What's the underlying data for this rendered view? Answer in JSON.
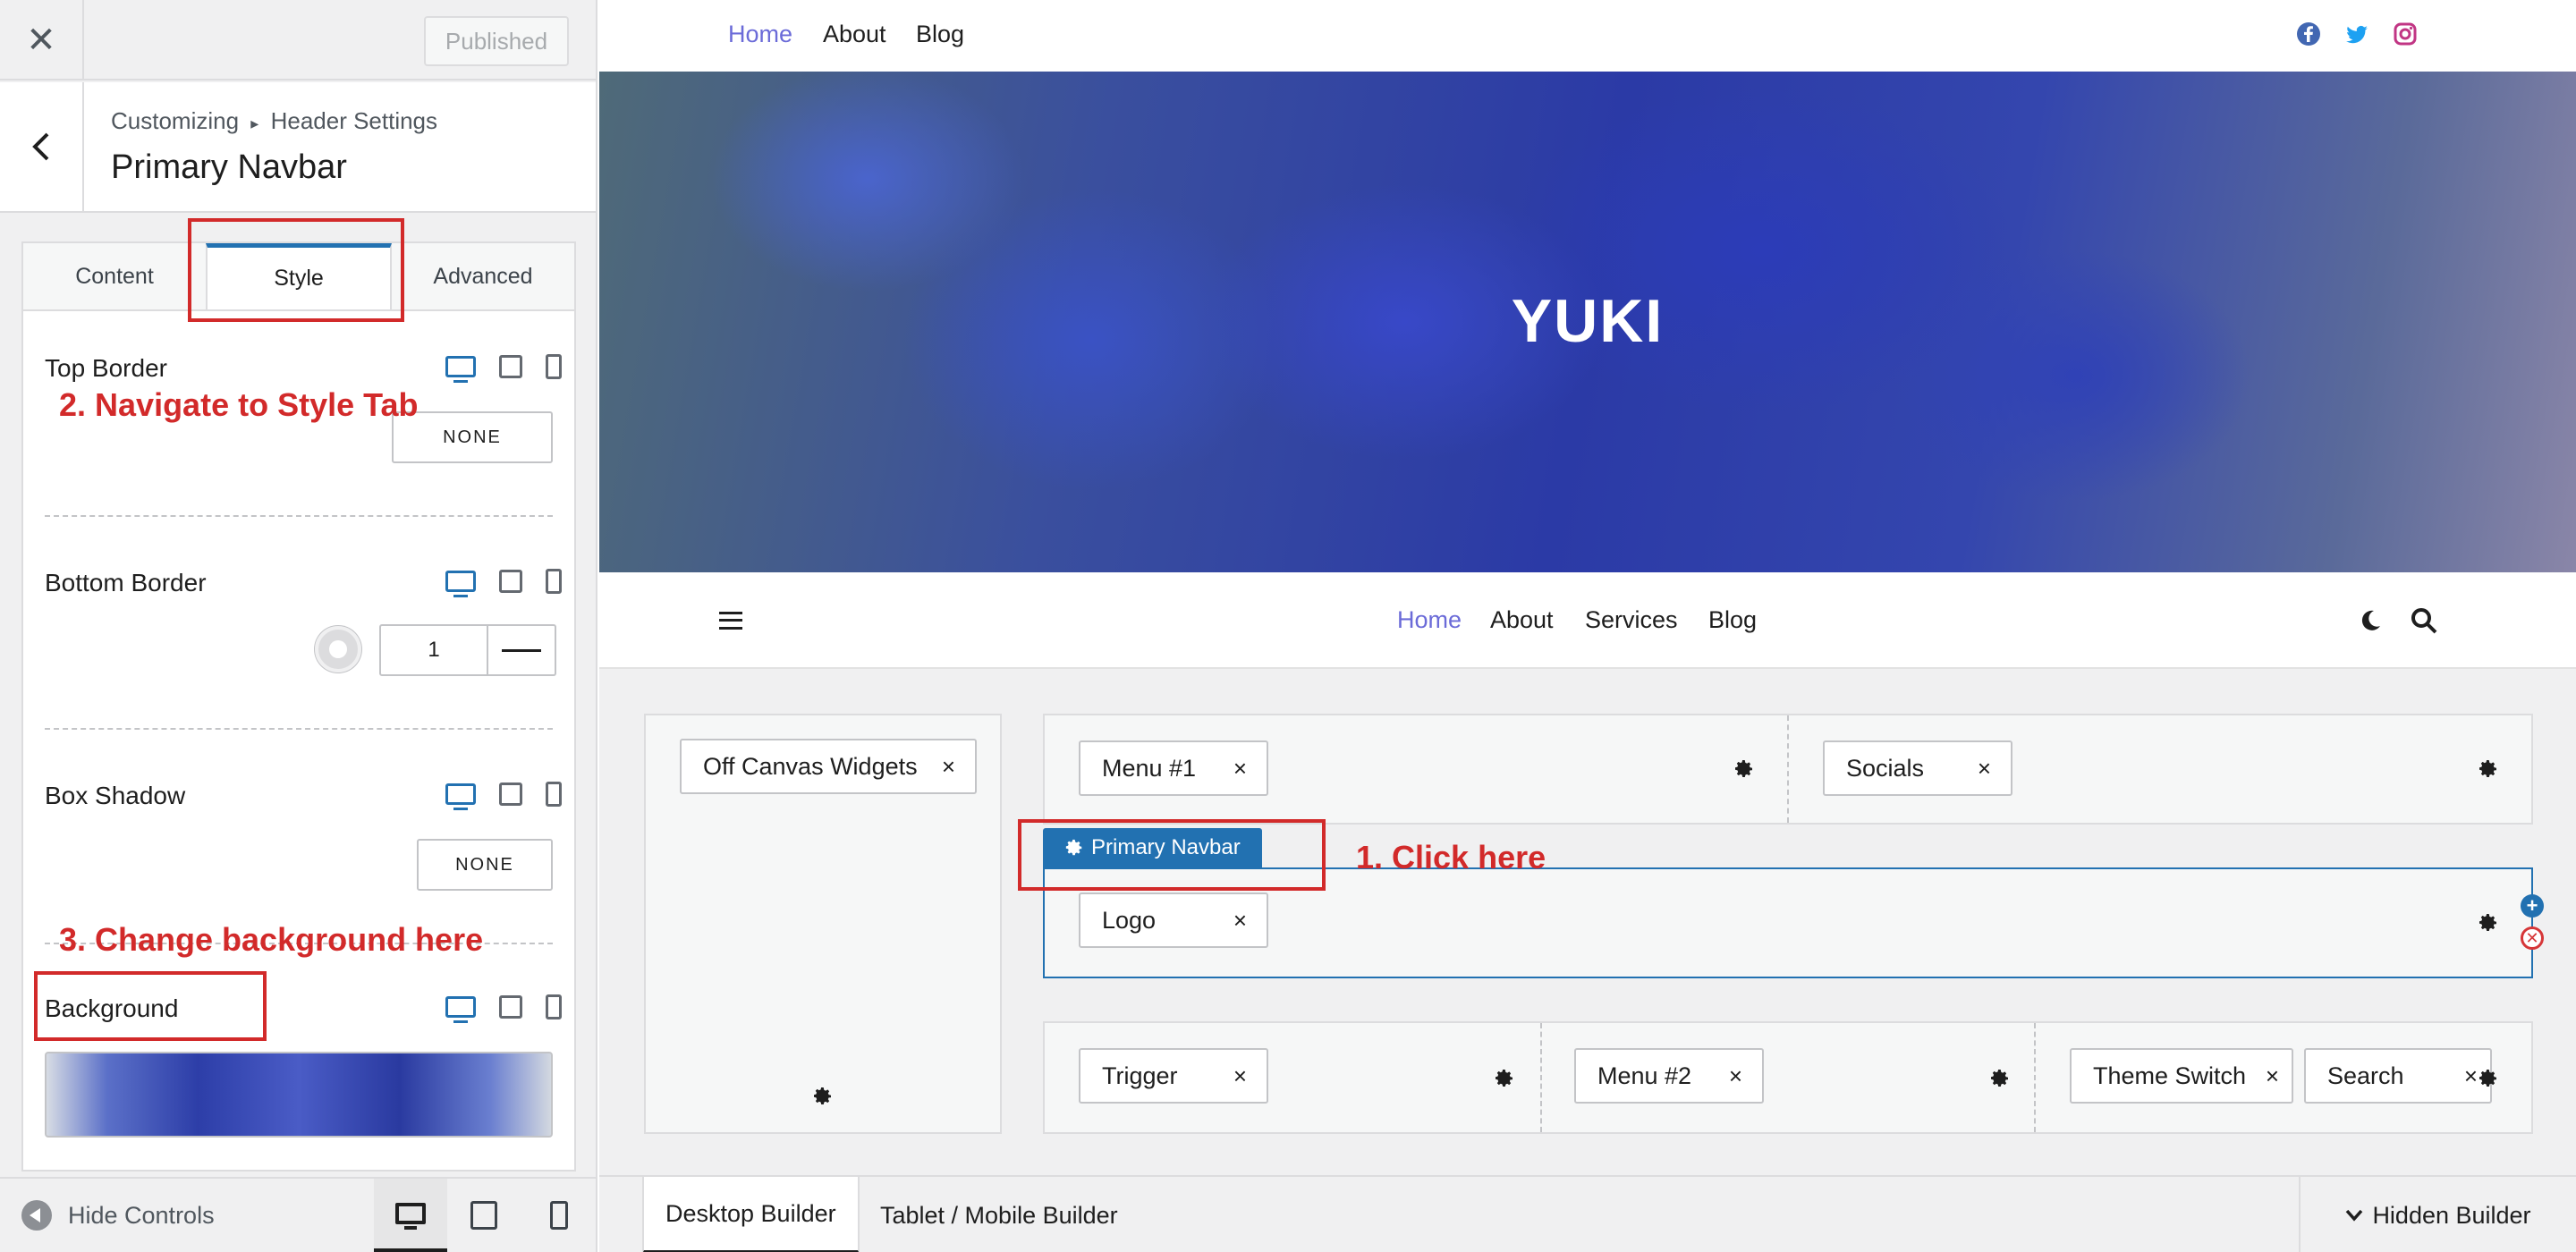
{
  "sidebar": {
    "close_label": "✕",
    "published_label": "Published",
    "breadcrumb": {
      "root": "Customizing",
      "separator": "▸",
      "section": "Header Settings"
    },
    "panel_title": "Primary Navbar",
    "tabs": [
      {
        "label": "Content",
        "active": false
      },
      {
        "label": "Style",
        "active": true
      },
      {
        "label": "Advanced",
        "active": false
      }
    ],
    "controls": {
      "top_border": {
        "label": "Top Border",
        "value": "NONE"
      },
      "bottom_border": {
        "label": "Bottom Border",
        "width": "1"
      },
      "box_shadow": {
        "label": "Box Shadow",
        "value": "NONE"
      },
      "background": {
        "label": "Background"
      }
    },
    "footer": {
      "hide_controls_label": "Hide Controls"
    }
  },
  "annotations": {
    "step1": "1. Click here",
    "step2": "2. Navigate to Style Tab",
    "step3": "3. Change background here",
    "color": "#d22a2a"
  },
  "preview": {
    "top_nav": [
      {
        "label": "Home",
        "active": true
      },
      {
        "label": "About",
        "active": false
      },
      {
        "label": "Blog",
        "active": false
      }
    ],
    "socials": [
      "facebook-icon",
      "twitter-icon",
      "instagram-icon"
    ],
    "hero_title": "YUKI",
    "main_nav": [
      {
        "label": "Home",
        "active": true
      },
      {
        "label": "About",
        "active": false
      },
      {
        "label": "Services",
        "active": false
      },
      {
        "label": "Blog",
        "active": false
      }
    ],
    "accent_color": "#6b6bd8"
  },
  "builder": {
    "off_canvas": {
      "label": "Off Canvas Widgets"
    },
    "top_row": {
      "left": "Menu #1",
      "right": "Socials"
    },
    "primary_row": {
      "badge": "Primary Navbar",
      "left": "Logo"
    },
    "bottom_row": {
      "left": "Trigger",
      "center": "Menu #2",
      "right_1": "Theme Switch",
      "right_2": "Search"
    },
    "remove_glyph": "×",
    "tabs": [
      {
        "label": "Desktop Builder",
        "active": true
      },
      {
        "label": "Tablet / Mobile Builder",
        "active": false
      }
    ],
    "hidden_builder_label": "Hidden Builder",
    "primary_color": "#2271b1"
  }
}
